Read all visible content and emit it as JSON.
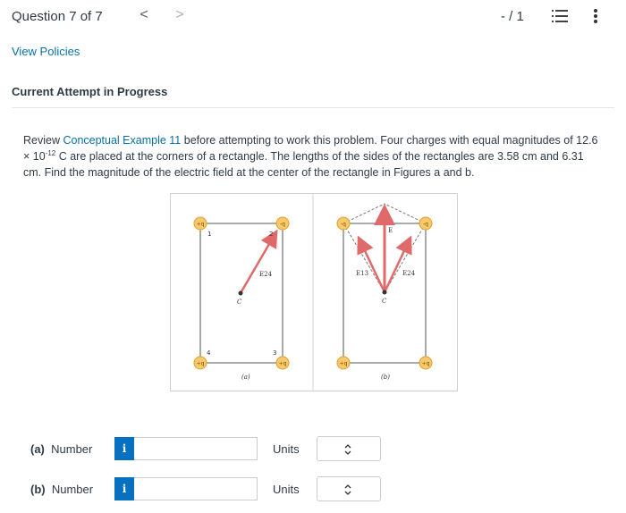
{
  "header": {
    "question_title": "Question 7 of 7",
    "prev_icon": "chevron-left-icon",
    "prev_glyph": "<",
    "next_icon": "chevron-right-icon",
    "next_glyph": ">",
    "score": "- / 1",
    "list_icon": "question-list-icon",
    "more_icon": "more-vertical-icon"
  },
  "links": {
    "view_policies": "View Policies"
  },
  "status": {
    "attempt": "Current Attempt in Progress"
  },
  "problem": {
    "intro": "Review ",
    "link_text": "Conceptual Example 11",
    "text_1": " before attempting to work this problem. Four charges with equal magnitudes of 12.6 × 10",
    "exponent": "-12",
    "text_2": " C are placed at the corners of a rectangle. The lengths of the sides of the rectangles are 3.58 cm and 6.31 cm. Find the magnitude of the electric field at the center of the rectangle in Figures a and b."
  },
  "figure": {
    "panel_a": {
      "caption": "(a)",
      "charges": [
        "+q",
        "-q",
        "+q",
        "+q"
      ],
      "corner_labels": [
        "1",
        "2",
        "4",
        "3"
      ],
      "center_label": "C",
      "field_label": "E24"
    },
    "panel_b": {
      "caption": "(b)",
      "charges": [
        "-q",
        "-q",
        "+q",
        "+q"
      ],
      "center_label": "C",
      "field_labels": [
        "E13",
        "E",
        "E24"
      ]
    },
    "colors": {
      "charge_fill": "#f7c96b",
      "arrow": "#e06a6a",
      "line": "#555555"
    }
  },
  "answers": [
    {
      "part": "(a)",
      "label": "Number",
      "info": "i",
      "value": "",
      "units_label": "Units",
      "units_value": ""
    },
    {
      "part": "(b)",
      "label": "Number",
      "info": "i",
      "value": "",
      "units_label": "Units",
      "units_value": ""
    }
  ],
  "colors": {
    "link": "#0770a3",
    "info_button": "#0770c0",
    "text": "#2d3b45"
  }
}
